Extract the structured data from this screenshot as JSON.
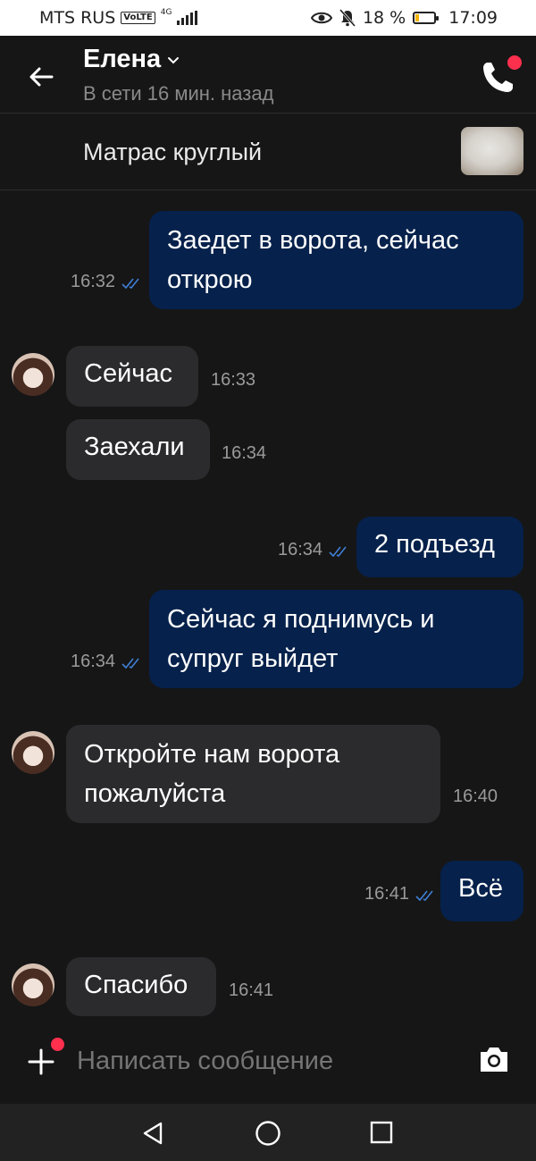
{
  "status_bar": {
    "carrier": "MTS RUS",
    "volte": "VoLTE",
    "network": "4G",
    "battery_percent": "18 %",
    "battery_level": 0.18,
    "time": "17:09"
  },
  "header": {
    "contact_name": "Елена",
    "presence": "В сети 16 мин. назад"
  },
  "listing": {
    "title": "Матрас круглый"
  },
  "messages": [
    {
      "direction": "out",
      "lines": [
        "Заедет в ворота, сейчас",
        "открою"
      ],
      "time": "16:32",
      "read": true
    },
    {
      "direction": "in",
      "lines": [
        "Сейчас"
      ],
      "time": "16:33",
      "avatar": true
    },
    {
      "direction": "in",
      "lines": [
        "Заехали"
      ],
      "time": "16:34",
      "avatar": false
    },
    {
      "direction": "out",
      "lines": [
        "2 подъезд"
      ],
      "time": "16:34",
      "read": true
    },
    {
      "direction": "out",
      "lines": [
        "Сейчас я поднимусь и",
        "супруг выйдет"
      ],
      "time": "16:34",
      "read": true
    },
    {
      "direction": "in",
      "lines": [
        "Откройте нам ворота",
        "пожалуйста"
      ],
      "time": "16:40",
      "avatar": true
    },
    {
      "direction": "out",
      "lines": [
        "Всё"
      ],
      "time": "16:41",
      "read": true
    },
    {
      "direction": "in",
      "lines": [
        "Спасибо"
      ],
      "time": "16:41",
      "avatar": true
    }
  ],
  "composer": {
    "placeholder": "Написать сообщение"
  },
  "colors": {
    "background": "#161616",
    "outgoing_bubble": "#06214b",
    "incoming_bubble": "#2b2b2d",
    "badge": "#ff2f4e",
    "read_ticks": "#3f7fd6"
  }
}
